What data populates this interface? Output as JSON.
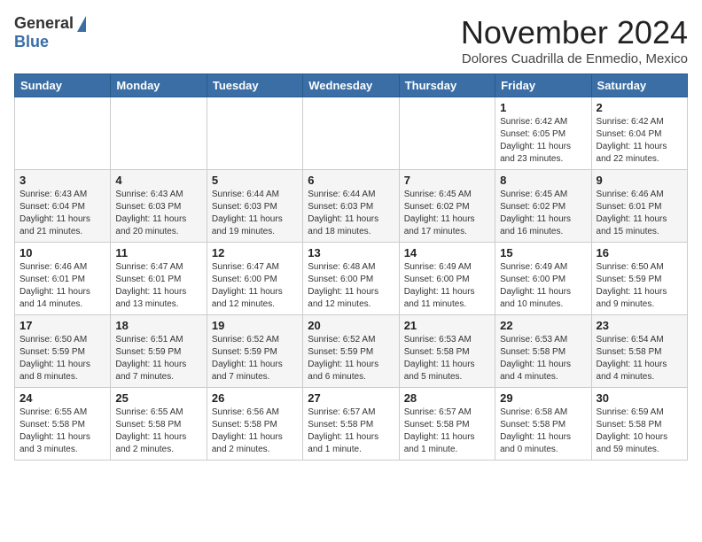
{
  "logo": {
    "general": "General",
    "blue": "Blue"
  },
  "header": {
    "month": "November 2024",
    "location": "Dolores Cuadrilla de Enmedio, Mexico"
  },
  "days_of_week": [
    "Sunday",
    "Monday",
    "Tuesday",
    "Wednesday",
    "Thursday",
    "Friday",
    "Saturday"
  ],
  "weeks": [
    [
      {
        "day": "",
        "info": ""
      },
      {
        "day": "",
        "info": ""
      },
      {
        "day": "",
        "info": ""
      },
      {
        "day": "",
        "info": ""
      },
      {
        "day": "",
        "info": ""
      },
      {
        "day": "1",
        "info": "Sunrise: 6:42 AM\nSunset: 6:05 PM\nDaylight: 11 hours\nand 23 minutes."
      },
      {
        "day": "2",
        "info": "Sunrise: 6:42 AM\nSunset: 6:04 PM\nDaylight: 11 hours\nand 22 minutes."
      }
    ],
    [
      {
        "day": "3",
        "info": "Sunrise: 6:43 AM\nSunset: 6:04 PM\nDaylight: 11 hours\nand 21 minutes."
      },
      {
        "day": "4",
        "info": "Sunrise: 6:43 AM\nSunset: 6:03 PM\nDaylight: 11 hours\nand 20 minutes."
      },
      {
        "day": "5",
        "info": "Sunrise: 6:44 AM\nSunset: 6:03 PM\nDaylight: 11 hours\nand 19 minutes."
      },
      {
        "day": "6",
        "info": "Sunrise: 6:44 AM\nSunset: 6:03 PM\nDaylight: 11 hours\nand 18 minutes."
      },
      {
        "day": "7",
        "info": "Sunrise: 6:45 AM\nSunset: 6:02 PM\nDaylight: 11 hours\nand 17 minutes."
      },
      {
        "day": "8",
        "info": "Sunrise: 6:45 AM\nSunset: 6:02 PM\nDaylight: 11 hours\nand 16 minutes."
      },
      {
        "day": "9",
        "info": "Sunrise: 6:46 AM\nSunset: 6:01 PM\nDaylight: 11 hours\nand 15 minutes."
      }
    ],
    [
      {
        "day": "10",
        "info": "Sunrise: 6:46 AM\nSunset: 6:01 PM\nDaylight: 11 hours\nand 14 minutes."
      },
      {
        "day": "11",
        "info": "Sunrise: 6:47 AM\nSunset: 6:01 PM\nDaylight: 11 hours\nand 13 minutes."
      },
      {
        "day": "12",
        "info": "Sunrise: 6:47 AM\nSunset: 6:00 PM\nDaylight: 11 hours\nand 12 minutes."
      },
      {
        "day": "13",
        "info": "Sunrise: 6:48 AM\nSunset: 6:00 PM\nDaylight: 11 hours\nand 12 minutes."
      },
      {
        "day": "14",
        "info": "Sunrise: 6:49 AM\nSunset: 6:00 PM\nDaylight: 11 hours\nand 11 minutes."
      },
      {
        "day": "15",
        "info": "Sunrise: 6:49 AM\nSunset: 6:00 PM\nDaylight: 11 hours\nand 10 minutes."
      },
      {
        "day": "16",
        "info": "Sunrise: 6:50 AM\nSunset: 5:59 PM\nDaylight: 11 hours\nand 9 minutes."
      }
    ],
    [
      {
        "day": "17",
        "info": "Sunrise: 6:50 AM\nSunset: 5:59 PM\nDaylight: 11 hours\nand 8 minutes."
      },
      {
        "day": "18",
        "info": "Sunrise: 6:51 AM\nSunset: 5:59 PM\nDaylight: 11 hours\nand 7 minutes."
      },
      {
        "day": "19",
        "info": "Sunrise: 6:52 AM\nSunset: 5:59 PM\nDaylight: 11 hours\nand 7 minutes."
      },
      {
        "day": "20",
        "info": "Sunrise: 6:52 AM\nSunset: 5:59 PM\nDaylight: 11 hours\nand 6 minutes."
      },
      {
        "day": "21",
        "info": "Sunrise: 6:53 AM\nSunset: 5:58 PM\nDaylight: 11 hours\nand 5 minutes."
      },
      {
        "day": "22",
        "info": "Sunrise: 6:53 AM\nSunset: 5:58 PM\nDaylight: 11 hours\nand 4 minutes."
      },
      {
        "day": "23",
        "info": "Sunrise: 6:54 AM\nSunset: 5:58 PM\nDaylight: 11 hours\nand 4 minutes."
      }
    ],
    [
      {
        "day": "24",
        "info": "Sunrise: 6:55 AM\nSunset: 5:58 PM\nDaylight: 11 hours\nand 3 minutes."
      },
      {
        "day": "25",
        "info": "Sunrise: 6:55 AM\nSunset: 5:58 PM\nDaylight: 11 hours\nand 2 minutes."
      },
      {
        "day": "26",
        "info": "Sunrise: 6:56 AM\nSunset: 5:58 PM\nDaylight: 11 hours\nand 2 minutes."
      },
      {
        "day": "27",
        "info": "Sunrise: 6:57 AM\nSunset: 5:58 PM\nDaylight: 11 hours\nand 1 minute."
      },
      {
        "day": "28",
        "info": "Sunrise: 6:57 AM\nSunset: 5:58 PM\nDaylight: 11 hours\nand 1 minute."
      },
      {
        "day": "29",
        "info": "Sunrise: 6:58 AM\nSunset: 5:58 PM\nDaylight: 11 hours\nand 0 minutes."
      },
      {
        "day": "30",
        "info": "Sunrise: 6:59 AM\nSunset: 5:58 PM\nDaylight: 10 hours\nand 59 minutes."
      }
    ]
  ]
}
